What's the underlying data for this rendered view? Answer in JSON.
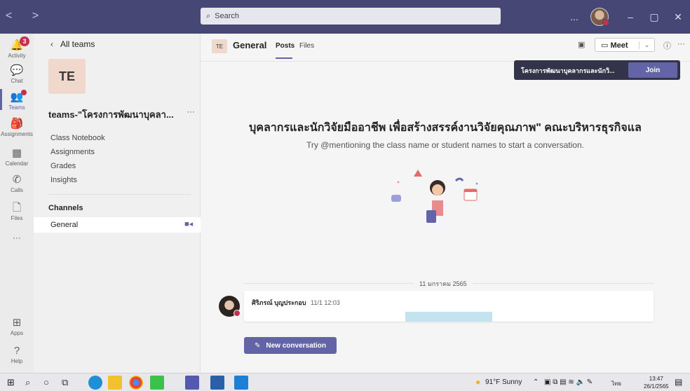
{
  "titlebar": {
    "nav_glyphs": "< >",
    "search_placeholder": "Search",
    "more_label": "...",
    "min_glyph": "–",
    "max_glyph": "▢",
    "close_glyph": "✕"
  },
  "rail": {
    "items": [
      {
        "label": "Activity",
        "icon": "bell-icon",
        "glyph": "🔔",
        "badge": "3"
      },
      {
        "label": "Chat",
        "icon": "chat-icon",
        "glyph": "💬"
      },
      {
        "label": "Teams",
        "icon": "teams-icon",
        "glyph": "👥"
      },
      {
        "label": "Assignments",
        "icon": "assignments-icon",
        "glyph": "🎒"
      },
      {
        "label": "Calendar",
        "icon": "calendar-icon",
        "glyph": "▦"
      },
      {
        "label": "Calls",
        "icon": "phone-icon",
        "glyph": "✆"
      },
      {
        "label": "Files",
        "icon": "file-icon",
        "glyph": "🗋"
      },
      {
        "label": "Apps",
        "icon": "apps-icon",
        "glyph": "⊞"
      },
      {
        "label": "Help",
        "icon": "help-icon",
        "glyph": "?"
      }
    ],
    "more": "···"
  },
  "panel": {
    "back": "All teams",
    "team_initials": "TE",
    "team_name": "teams-\"โครงการพัฒนาบุคลา...",
    "team_more": "···",
    "links": [
      "Class Notebook",
      "Assignments",
      "Grades",
      "Insights"
    ],
    "channels_header": "Channels",
    "channel": "General"
  },
  "header": {
    "tag": "TE",
    "title": "General",
    "tabs": [
      "Posts",
      "Files"
    ],
    "meet": "Meet",
    "meet_chevron": "⌄",
    "info": "ⓘ",
    "more": "···"
  },
  "join": {
    "text": "โครงการพัฒนาบุคลากรและนักวิ...",
    "button": "Join"
  },
  "main": {
    "headline": "บุคลากรและนักวิจัยมืออาชีพ เพื่อสร้างสรรค์งานวิจัยคุณภาพ\" คณะบริหารธุรกิจแล",
    "subline": "Try @mentioning the class name or student names to start a conversation.",
    "date": "11 มกราคม 2565",
    "post_author": "ศิริภรณ์ บุญประกอบ",
    "post_time": "11/1 12:03",
    "new_conversation": "New conversation"
  },
  "taskbar": {
    "weather": "91°F Sunny",
    "lang": "ไทย",
    "time": "13:47",
    "date": "26/1/2565"
  },
  "colors": {
    "brand": "#6264a7",
    "titlebar": "#464775",
    "badge": "#c4314b"
  }
}
